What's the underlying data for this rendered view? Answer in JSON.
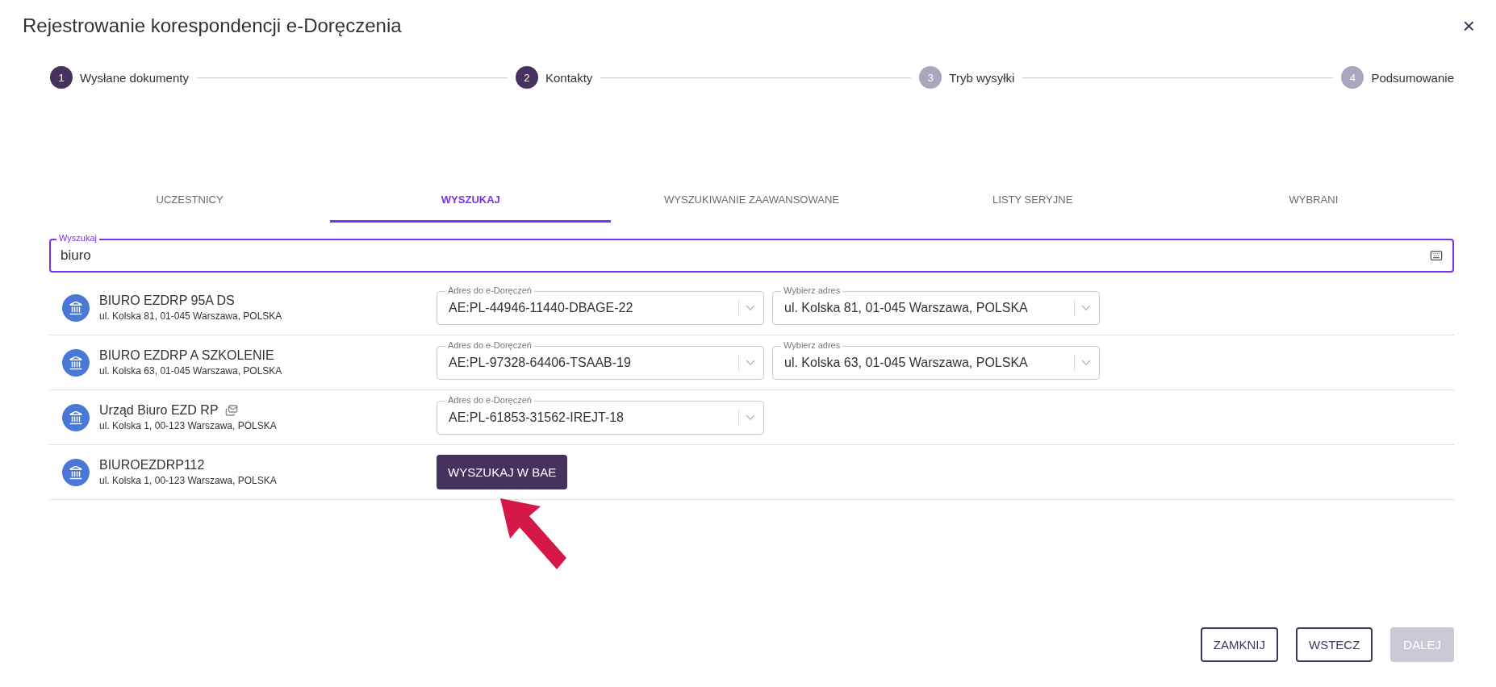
{
  "window": {
    "title": "Rejestrowanie korespondencji e-Doręczenia",
    "close": "×"
  },
  "steps": [
    {
      "number": "1",
      "label": "Wysłane dokumenty",
      "active": true
    },
    {
      "number": "2",
      "label": "Kontakty",
      "active": true
    },
    {
      "number": "3",
      "label": "Tryb wysyłki",
      "active": false
    },
    {
      "number": "4",
      "label": "Podsumowanie",
      "active": false
    }
  ],
  "tabs": [
    {
      "label": "UCZESTNICY",
      "selected": false
    },
    {
      "label": "WYSZUKAJ",
      "selected": true
    },
    {
      "label": "WYSZUKIWANIE ZAAWANSOWANE",
      "selected": false
    },
    {
      "label": "LISTY SERYJNE",
      "selected": false
    },
    {
      "label": "WYBRANI",
      "selected": false
    }
  ],
  "search": {
    "label": "Wyszukaj",
    "value": "biuro"
  },
  "results": [
    {
      "kind": "selects",
      "name": "BIURO EZDRP 95A DS",
      "address": "ul. Kolska 81, 01-045 Warszawa, POLSKA",
      "mail_icon": false,
      "selects": [
        {
          "label": "Adres do e-Doręczeń",
          "value": "AE:PL-44946-11440-DBAGE-22"
        },
        {
          "label": "Wybierz adres",
          "value": "ul. Kolska 81, 01-045 Warszawa, POLSKA"
        }
      ]
    },
    {
      "kind": "selects",
      "name": "BIURO EZDRP A SZKOLENIE",
      "address": "ul. Kolska 63, 01-045 Warszawa, POLSKA",
      "mail_icon": false,
      "selects": [
        {
          "label": "Adres do e-Doręczeń",
          "value": "AE:PL-97328-64406-TSAAB-19"
        },
        {
          "label": "Wybierz adres",
          "value": "ul. Kolska 63, 01-045 Warszawa, POLSKA"
        }
      ]
    },
    {
      "kind": "selects",
      "name": "Urząd Biuro EZD RP",
      "address": "ul. Kolska 1, 00-123 Warszawa, POLSKA",
      "mail_icon": true,
      "selects": [
        {
          "label": "Adres do e-Doręczeń",
          "value": "AE:PL-61853-31562-IREJT-18"
        }
      ]
    },
    {
      "kind": "button",
      "name": "BIUROEZDRP112",
      "address": "ul. Kolska 1, 00-123 Warszawa, POLSKA",
      "mail_icon": false,
      "button": "WYSZUKAJ W BAE"
    }
  ],
  "footer_buttons": [
    {
      "label": "ZAMKNIJ",
      "disabled": false
    },
    {
      "label": "WSTECZ",
      "disabled": false
    },
    {
      "label": "DALEJ",
      "disabled": true
    }
  ]
}
